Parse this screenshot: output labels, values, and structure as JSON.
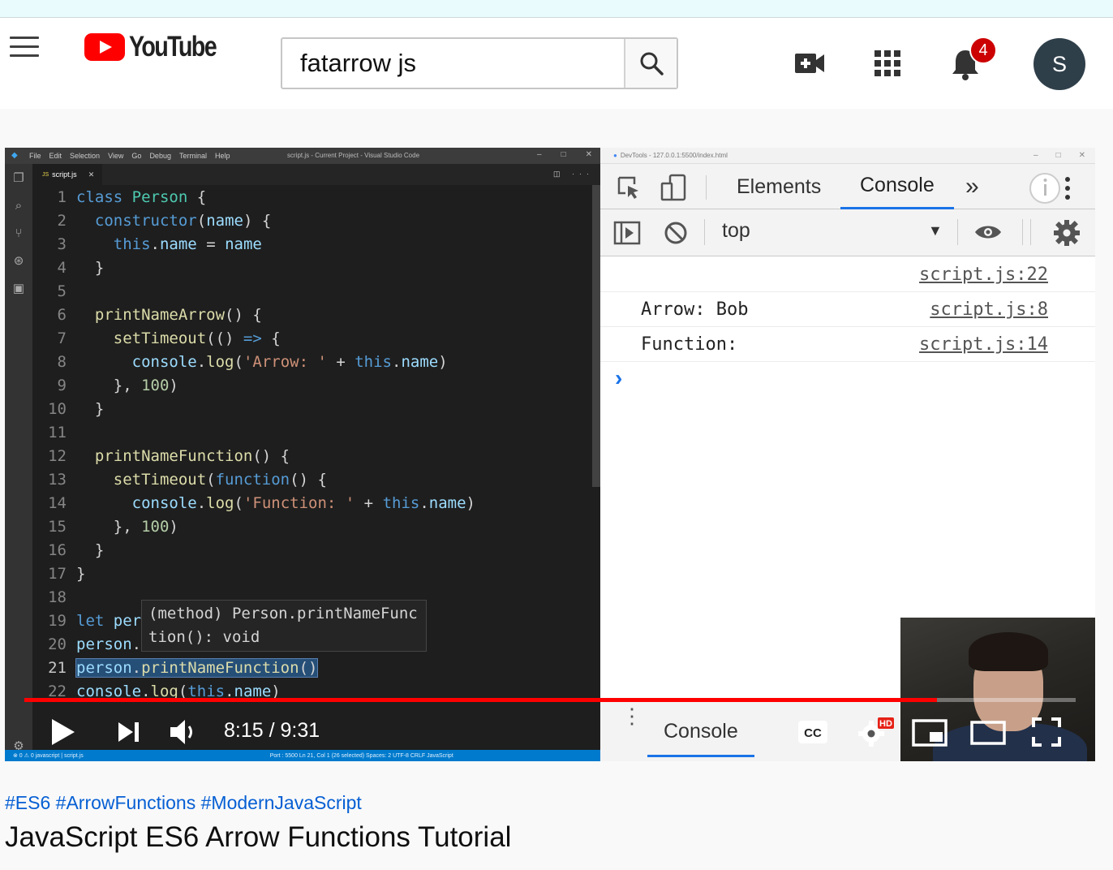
{
  "masthead": {
    "logo_text": "YouTube",
    "search_value": "fatarrow js",
    "notification_count": "4",
    "avatar_initial": "S"
  },
  "vscode": {
    "menu": [
      "File",
      "Edit",
      "Selection",
      "View",
      "Go",
      "Debug",
      "Terminal",
      "Help"
    ],
    "window_title": "script.js - Current Project - Visual Studio Code",
    "tab_label": "script.js",
    "tab_badge": "JS",
    "hover_tip": [
      "(method) Person.printNameFunc",
      "tion(): void"
    ],
    "status_left": "⊗ 0 ⚠ 0   javascript | script.js",
    "status_right": "Port : 5500    Ln 21, Col 1 (26 selected)    Spaces: 2    UTF-8    CRLF    JavaScript"
  },
  "devtools": {
    "window_title": "DevTools - 127.0.0.1:5500/index.html",
    "tabs": [
      "Elements",
      "Console"
    ],
    "more_tabs": "»",
    "context": "top",
    "rows": [
      {
        "message": "",
        "source": "script.js:22"
      },
      {
        "message": "Arrow: Bob",
        "source": "script.js:8"
      },
      {
        "message": "Function:",
        "source": "script.js:14"
      }
    ],
    "prompt": "›",
    "drawer_tab": "Console"
  },
  "player": {
    "time_display": "8:15 / 9:31",
    "progress_fraction": 0.868,
    "hd_badge": "HD"
  },
  "video": {
    "hashtags": [
      "#ES6",
      "#ArrowFunctions",
      "#ModernJavaScript"
    ],
    "title": "JavaScript ES6 Arrow Functions Tutorial"
  }
}
